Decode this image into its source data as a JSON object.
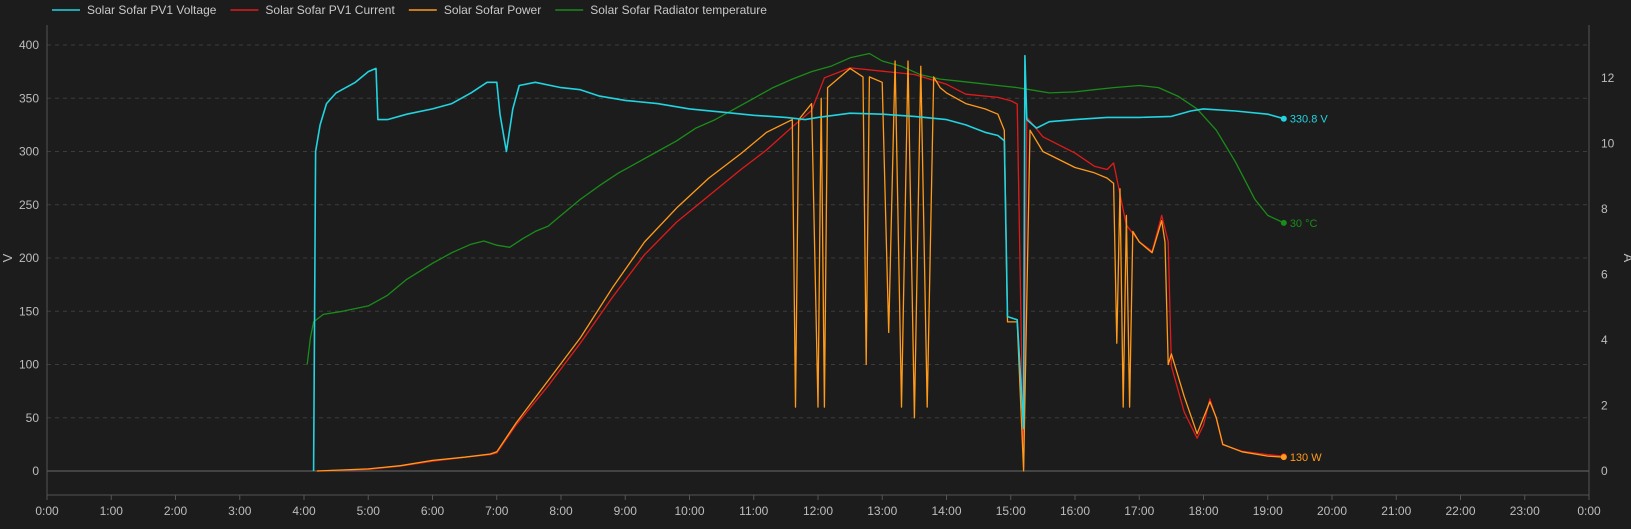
{
  "chart_data": {
    "type": "line",
    "x_unit": "time of day",
    "x_ticks": [
      "0:00",
      "1:00",
      "2:00",
      "3:00",
      "4:00",
      "5:00",
      "6:00",
      "7:00",
      "8:00",
      "9:00",
      "10:00",
      "11:00",
      "12:00",
      "13:00",
      "14:00",
      "15:00",
      "16:00",
      "17:00",
      "18:00",
      "19:00",
      "20:00",
      "21:00",
      "22:00",
      "23:00",
      "0:00"
    ],
    "xlim": [
      0,
      24
    ],
    "y_left": {
      "label": "V",
      "ylim": [
        0,
        400
      ],
      "ticks": [
        0,
        50,
        100,
        150,
        200,
        250,
        300,
        350,
        400
      ]
    },
    "y_right": {
      "label": "A",
      "ylim": [
        0,
        13
      ],
      "ticks": [
        0,
        2,
        4,
        6,
        8,
        10,
        12
      ]
    },
    "grid": true,
    "legend_position": "top-left",
    "series": [
      {
        "name": "Solar Sofar PV1 Voltage",
        "axis": "left",
        "color": "#22d3e0",
        "end_label": "330.8 V",
        "points": [
          [
            4.15,
            0
          ],
          [
            4.18,
            300
          ],
          [
            4.25,
            325
          ],
          [
            4.35,
            345
          ],
          [
            4.5,
            355
          ],
          [
            4.8,
            365
          ],
          [
            5.0,
            375
          ],
          [
            5.12,
            378
          ],
          [
            5.15,
            330
          ],
          [
            5.3,
            330
          ],
          [
            5.6,
            335
          ],
          [
            6.0,
            340
          ],
          [
            6.3,
            345
          ],
          [
            6.6,
            355
          ],
          [
            6.85,
            365
          ],
          [
            7.0,
            365
          ],
          [
            7.05,
            335
          ],
          [
            7.15,
            300
          ],
          [
            7.25,
            340
          ],
          [
            7.35,
            362
          ],
          [
            7.6,
            365
          ],
          [
            8.0,
            360
          ],
          [
            8.3,
            358
          ],
          [
            8.6,
            352
          ],
          [
            9.0,
            348
          ],
          [
            9.5,
            345
          ],
          [
            10.0,
            340
          ],
          [
            10.5,
            337
          ],
          [
            11.0,
            334
          ],
          [
            11.5,
            332
          ],
          [
            11.8,
            330
          ],
          [
            12.0,
            332
          ],
          [
            12.5,
            336
          ],
          [
            13.0,
            335
          ],
          [
            13.5,
            333
          ],
          [
            14.0,
            330
          ],
          [
            14.3,
            325
          ],
          [
            14.6,
            318
          ],
          [
            14.8,
            315
          ],
          [
            14.9,
            310
          ],
          [
            14.95,
            145
          ],
          [
            15.1,
            142
          ],
          [
            15.2,
            40
          ],
          [
            15.22,
            390
          ],
          [
            15.25,
            330
          ],
          [
            15.4,
            322
          ],
          [
            15.6,
            328
          ],
          [
            16.0,
            330
          ],
          [
            16.5,
            332
          ],
          [
            17.0,
            332
          ],
          [
            17.5,
            333
          ],
          [
            17.8,
            338
          ],
          [
            18.0,
            340
          ],
          [
            18.5,
            338
          ],
          [
            19.0,
            335
          ],
          [
            19.25,
            330.8
          ]
        ]
      },
      {
        "name": "Solar Sofar PV1 Current",
        "axis": "right",
        "color": "#e01a1a",
        "end_label": "",
        "points": [
          [
            4.2,
            0
          ],
          [
            5.0,
            0.05
          ],
          [
            5.5,
            0.15
          ],
          [
            6.0,
            0.3
          ],
          [
            6.5,
            0.42
          ],
          [
            6.9,
            0.5
          ],
          [
            7.0,
            0.55
          ],
          [
            7.3,
            1.4
          ],
          [
            7.8,
            2.6
          ],
          [
            8.3,
            3.9
          ],
          [
            8.8,
            5.3
          ],
          [
            9.3,
            6.6
          ],
          [
            9.8,
            7.6
          ],
          [
            10.3,
            8.4
          ],
          [
            10.8,
            9.2
          ],
          [
            11.2,
            9.8
          ],
          [
            11.6,
            10.5
          ],
          [
            11.9,
            11.0
          ],
          [
            12.1,
            12.0
          ],
          [
            12.5,
            12.3
          ],
          [
            13.0,
            12.2
          ],
          [
            13.5,
            12.1
          ],
          [
            14.0,
            11.8
          ],
          [
            14.3,
            11.5
          ],
          [
            14.8,
            11.4
          ],
          [
            15.0,
            11.3
          ],
          [
            15.1,
            11.2
          ],
          [
            15.2,
            0.1
          ],
          [
            15.25,
            10.8
          ],
          [
            15.5,
            10.2
          ],
          [
            16.0,
            9.7
          ],
          [
            16.3,
            9.3
          ],
          [
            16.5,
            9.2
          ],
          [
            16.6,
            9.4
          ],
          [
            16.8,
            7.5
          ],
          [
            17.0,
            7.0
          ],
          [
            17.2,
            6.7
          ],
          [
            17.35,
            7.8
          ],
          [
            17.45,
            7.0
          ],
          [
            17.5,
            3.2
          ],
          [
            17.7,
            1.8
          ],
          [
            17.9,
            1.0
          ],
          [
            18.0,
            1.4
          ],
          [
            18.1,
            2.2
          ],
          [
            18.2,
            1.6
          ],
          [
            18.3,
            0.8
          ],
          [
            18.6,
            0.6
          ],
          [
            19.0,
            0.5
          ],
          [
            19.25,
            0.45
          ]
        ]
      },
      {
        "name": "Solar Sofar Power",
        "axis": "left",
        "color": "#ff9a1a",
        "end_label": "130 W",
        "points": [
          [
            4.2,
            0
          ],
          [
            5.0,
            2
          ],
          [
            5.5,
            5
          ],
          [
            6.0,
            10
          ],
          [
            6.5,
            13
          ],
          [
            6.9,
            16
          ],
          [
            7.0,
            18
          ],
          [
            7.3,
            45
          ],
          [
            7.8,
            85
          ],
          [
            8.3,
            125
          ],
          [
            8.8,
            172
          ],
          [
            9.3,
            215
          ],
          [
            9.8,
            247
          ],
          [
            10.3,
            275
          ],
          [
            10.8,
            298
          ],
          [
            11.2,
            318
          ],
          [
            11.6,
            330
          ],
          [
            11.65,
            60
          ],
          [
            11.7,
            330
          ],
          [
            11.9,
            345
          ],
          [
            12.0,
            60
          ],
          [
            12.05,
            350
          ],
          [
            12.1,
            60
          ],
          [
            12.15,
            360
          ],
          [
            12.5,
            378
          ],
          [
            12.7,
            370
          ],
          [
            12.75,
            100
          ],
          [
            12.8,
            370
          ],
          [
            13.0,
            365
          ],
          [
            13.1,
            130
          ],
          [
            13.2,
            385
          ],
          [
            13.3,
            60
          ],
          [
            13.4,
            385
          ],
          [
            13.5,
            50
          ],
          [
            13.6,
            380
          ],
          [
            13.7,
            60
          ],
          [
            13.8,
            370
          ],
          [
            13.9,
            360
          ],
          [
            14.0,
            355
          ],
          [
            14.3,
            345
          ],
          [
            14.6,
            340
          ],
          [
            14.8,
            335
          ],
          [
            14.9,
            320
          ],
          [
            14.95,
            140
          ],
          [
            15.1,
            140
          ],
          [
            15.2,
            0
          ],
          [
            15.3,
            320
          ],
          [
            15.5,
            300
          ],
          [
            16.0,
            285
          ],
          [
            16.3,
            280
          ],
          [
            16.5,
            275
          ],
          [
            16.6,
            270
          ],
          [
            16.65,
            120
          ],
          [
            16.7,
            265
          ],
          [
            16.75,
            60
          ],
          [
            16.8,
            240
          ],
          [
            16.85,
            60
          ],
          [
            16.9,
            225
          ],
          [
            17.0,
            215
          ],
          [
            17.2,
            205
          ],
          [
            17.35,
            235
          ],
          [
            17.4,
            215
          ],
          [
            17.45,
            100
          ],
          [
            17.5,
            110
          ],
          [
            17.7,
            70
          ],
          [
            17.9,
            35
          ],
          [
            18.0,
            50
          ],
          [
            18.1,
            65
          ],
          [
            18.2,
            50
          ],
          [
            18.3,
            25
          ],
          [
            18.6,
            18
          ],
          [
            19.0,
            14
          ],
          [
            19.25,
            13
          ]
        ]
      },
      {
        "name": "Solar Sofar Radiator temperature",
        "axis": "left",
        "color": "#1a8c1a",
        "end_label": "30 °C",
        "points": [
          [
            4.05,
            100
          ],
          [
            4.1,
            125
          ],
          [
            4.15,
            140
          ],
          [
            4.3,
            147
          ],
          [
            4.6,
            150
          ],
          [
            5.0,
            155
          ],
          [
            5.3,
            165
          ],
          [
            5.6,
            180
          ],
          [
            6.0,
            195
          ],
          [
            6.3,
            205
          ],
          [
            6.6,
            213
          ],
          [
            6.8,
            216
          ],
          [
            7.0,
            212
          ],
          [
            7.2,
            210
          ],
          [
            7.4,
            218
          ],
          [
            7.6,
            225
          ],
          [
            7.8,
            230
          ],
          [
            8.0,
            240
          ],
          [
            8.3,
            255
          ],
          [
            8.6,
            268
          ],
          [
            8.9,
            280
          ],
          [
            9.2,
            290
          ],
          [
            9.5,
            300
          ],
          [
            9.8,
            310
          ],
          [
            10.1,
            322
          ],
          [
            10.4,
            330
          ],
          [
            10.7,
            340
          ],
          [
            11.0,
            350
          ],
          [
            11.3,
            360
          ],
          [
            11.6,
            368
          ],
          [
            11.9,
            375
          ],
          [
            12.2,
            380
          ],
          [
            12.5,
            388
          ],
          [
            12.8,
            392
          ],
          [
            13.0,
            385
          ],
          [
            13.3,
            380
          ],
          [
            13.6,
            372
          ],
          [
            13.9,
            368
          ],
          [
            14.2,
            366
          ],
          [
            14.5,
            364
          ],
          [
            14.8,
            362
          ],
          [
            15.1,
            360
          ],
          [
            15.3,
            358
          ],
          [
            15.6,
            355
          ],
          [
            16.0,
            356
          ],
          [
            16.3,
            358
          ],
          [
            16.6,
            360
          ],
          [
            17.0,
            362
          ],
          [
            17.3,
            360
          ],
          [
            17.6,
            352
          ],
          [
            17.9,
            340
          ],
          [
            18.2,
            320
          ],
          [
            18.5,
            290
          ],
          [
            18.8,
            255
          ],
          [
            19.0,
            240
          ],
          [
            19.25,
            233
          ]
        ]
      }
    ]
  }
}
